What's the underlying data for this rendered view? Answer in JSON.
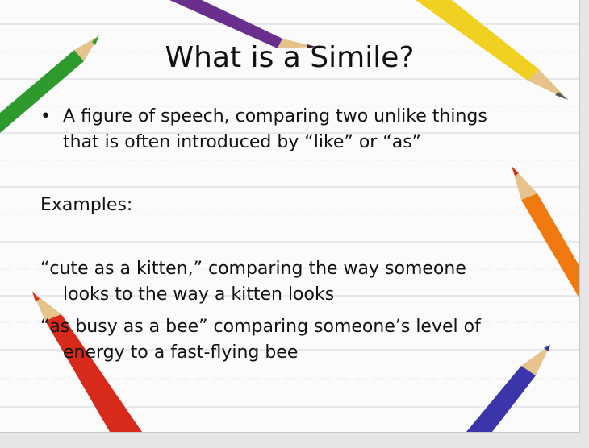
{
  "slide": {
    "title": "What is a Simile?",
    "bullet": {
      "marker": "•",
      "line1": "A figure of speech, comparing two unlike things",
      "line2": "that is often introduced by “like” or “as”"
    },
    "examples_heading": "Examples:",
    "examples": [
      {
        "line1": "“cute as a kitten,” comparing the way someone",
        "line2": "looks to the way a kitten looks"
      },
      {
        "line1": "“as busy as a bee” comparing someone’s level of",
        "line2": "energy to a fast-flying bee"
      }
    ],
    "pencil_colors": [
      "#2e9a2e",
      "#6a2f8c",
      "#f0d020",
      "#f07a10",
      "#d82a1a",
      "#3a35a8"
    ]
  }
}
